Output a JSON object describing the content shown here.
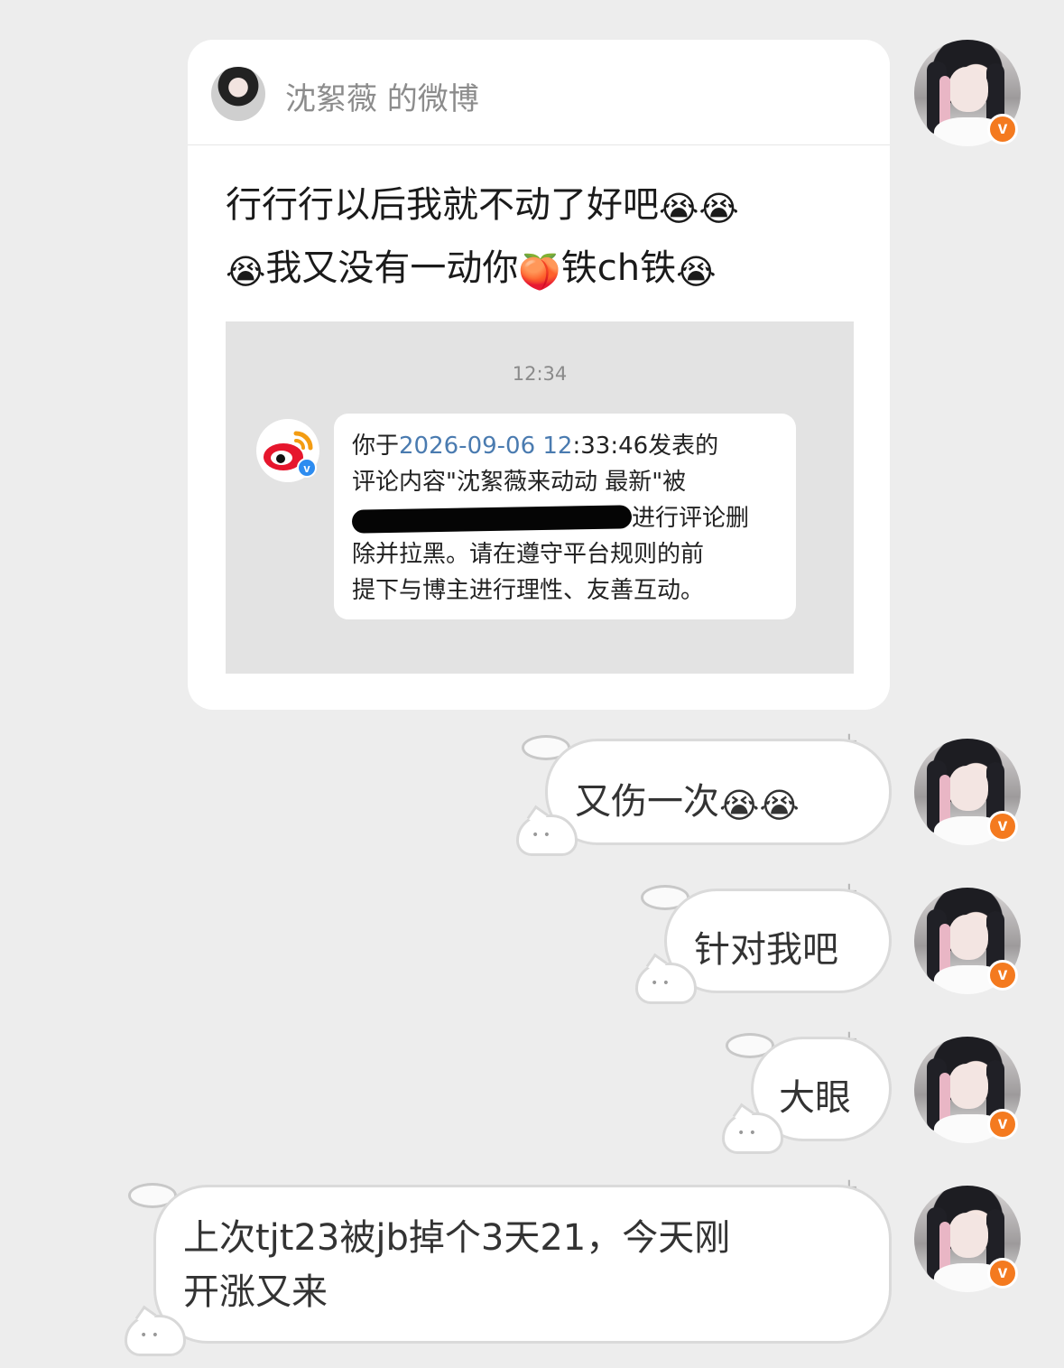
{
  "card": {
    "title": "沈絮薇 的微博",
    "line1_text": "行行行以后我就不动了好吧",
    "line2_a": "我又没有一动你",
    "line2_b": "铁ch铁",
    "emoji_cry": "😭",
    "emoji_peach": "🍑"
  },
  "screenshot": {
    "time": "12:34",
    "notice_prefix": "你于",
    "notice_link": "2026-09-06 12",
    "notice_after_link": ":33:46发表的",
    "notice_line2": "评论内容\"沈絮薇来动动  最新\"被",
    "notice_line3_tail": "进行评论删",
    "notice_line4": "除并拉黑。请在遵守平台规则的前",
    "notice_line5": "提下与博主进行理性、友善互动。",
    "verified_mark": "v"
  },
  "messages": [
    {
      "text": "又伤一次"
    },
    {
      "text": "针对我吧"
    },
    {
      "text": "大眼"
    },
    {
      "line1": "上次tjt23被jb掉个3天21，今天刚",
      "line2": "开涨又来"
    }
  ],
  "badge_letter": "v",
  "colors": {
    "background": "#ededed",
    "badge": "#f47a1f",
    "link": "#4a7bb0"
  }
}
